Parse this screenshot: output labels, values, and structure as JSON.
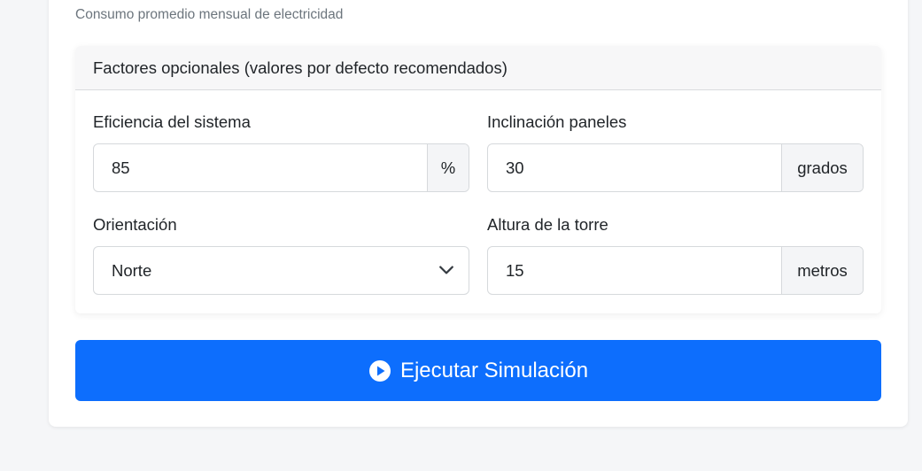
{
  "help_text": "Consumo promedio mensual de electricidad",
  "optional_factors": {
    "header": "Factores opcionales (valores por defecto recomendados)",
    "efficiency": {
      "label": "Eficiencia del sistema",
      "value": "85",
      "unit": "%"
    },
    "tilt": {
      "label": "Inclinación paneles",
      "value": "30",
      "unit": "grados"
    },
    "orientation": {
      "label": "Orientación",
      "selected": "Norte"
    },
    "tower_height": {
      "label": "Altura de la torre",
      "value": "15",
      "unit": "metros"
    }
  },
  "run_button": {
    "label": "Ejecutar Simulación",
    "icon": "play-circle-icon"
  },
  "colors": {
    "primary": "#0d6efd",
    "muted_text": "#6c757d",
    "header_bg": "#f7f7f8"
  }
}
